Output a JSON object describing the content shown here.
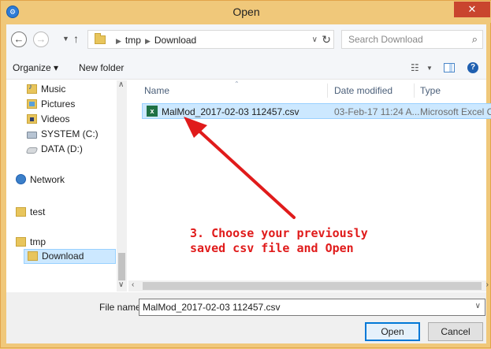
{
  "window": {
    "title": "Open",
    "close_label": "✕"
  },
  "address": {
    "crumbs": [
      "tmp",
      "Download"
    ],
    "search_placeholder": "Search Download"
  },
  "toolbar": {
    "organize_label": "Organize ▾",
    "new_folder_label": "New folder"
  },
  "nav": {
    "items": [
      {
        "label": "Music"
      },
      {
        "label": "Pictures"
      },
      {
        "label": "Videos"
      },
      {
        "label": "SYSTEM (C:)"
      },
      {
        "label": "DATA (D:)"
      },
      {
        "label": "Network"
      },
      {
        "label": "test"
      },
      {
        "label": "tmp"
      },
      {
        "label": "Download"
      }
    ]
  },
  "columns": {
    "name": "Name",
    "date_modified": "Date modified",
    "type": "Type"
  },
  "files": [
    {
      "name": "MalMod_2017-02-03 112457.csv",
      "date_modified": "03-Feb-17 11:24 A...",
      "type": "Microsoft Excel Co..."
    }
  ],
  "bottom": {
    "file_name_label": "File name:",
    "file_name_value": "MalMod_2017-02-03 112457.csv",
    "open_label": "Open",
    "cancel_label": "Cancel"
  },
  "annotation": {
    "text": "3. Choose your previously\nsaved csv file and Open",
    "color": "#e01b1b"
  },
  "colors": {
    "accent": "#0078d7",
    "selection": "#cce8ff",
    "frame": "#f0c87a"
  }
}
